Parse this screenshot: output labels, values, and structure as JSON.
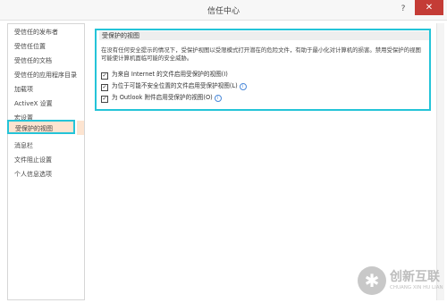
{
  "window": {
    "title": "信任中心",
    "help": "?",
    "close": "✕"
  },
  "sidebar": {
    "items": [
      {
        "label": "受信任的发布者"
      },
      {
        "label": "受信任位置"
      },
      {
        "label": "受信任的文档"
      },
      {
        "label": "受信任的应用程序目录"
      },
      {
        "label": "加载项"
      },
      {
        "label": "ActiveX 设置"
      },
      {
        "label": "宏设置"
      },
      {
        "label": "受保护的视图",
        "selected": true
      },
      {
        "label": "消息栏"
      },
      {
        "label": "文件阻止设置"
      },
      {
        "label": "个人信息选项"
      }
    ]
  },
  "section": {
    "heading": "受保护的视图",
    "description": "在没有任何安全提示的情况下，受保护视图以受限模式打开潜在的危险文件，有助于最小化对计算机的损害。禁用受保护的视图可能使计算机面临可能的安全威胁。",
    "options": [
      {
        "label": "为来自 Internet 的文件启用受保护的视图(I)",
        "checked": true,
        "info": false
      },
      {
        "label": "为位于可能不安全位置的文件启用受保护视图(L)",
        "checked": true,
        "info": true
      },
      {
        "label": "为 Outlook 附件启用受保护的视图(O)",
        "checked": true,
        "info": true
      }
    ]
  },
  "watermark": {
    "logo": "✱",
    "brand": "创新互联",
    "sub": "CHUANG XIN HU LIAN"
  }
}
